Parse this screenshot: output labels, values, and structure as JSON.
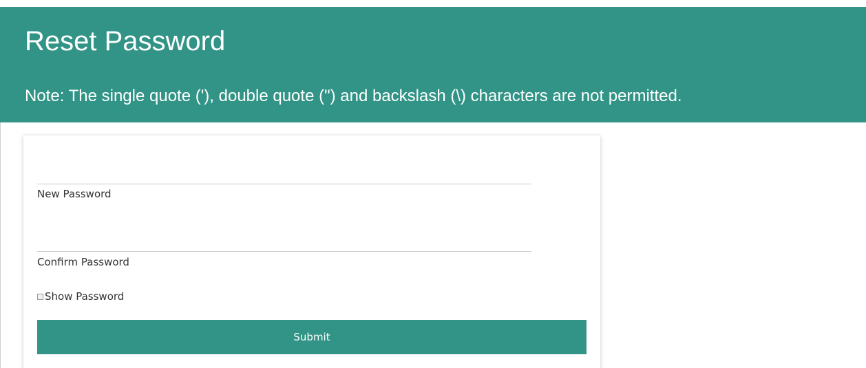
{
  "header": {
    "title": "Reset Password",
    "note": "Note: The single quote ('), double quote (\") and backslash (\\) characters are not permitted."
  },
  "form": {
    "new_password": {
      "label": "New Password",
      "value": ""
    },
    "confirm_password": {
      "label": "Confirm Password",
      "value": ""
    },
    "show_password": {
      "label": "Show Password",
      "checked": false
    },
    "submit_label": "Submit"
  },
  "colors": {
    "accent": "#319486",
    "header_text": "#ffffff",
    "label_text": "#333333"
  }
}
